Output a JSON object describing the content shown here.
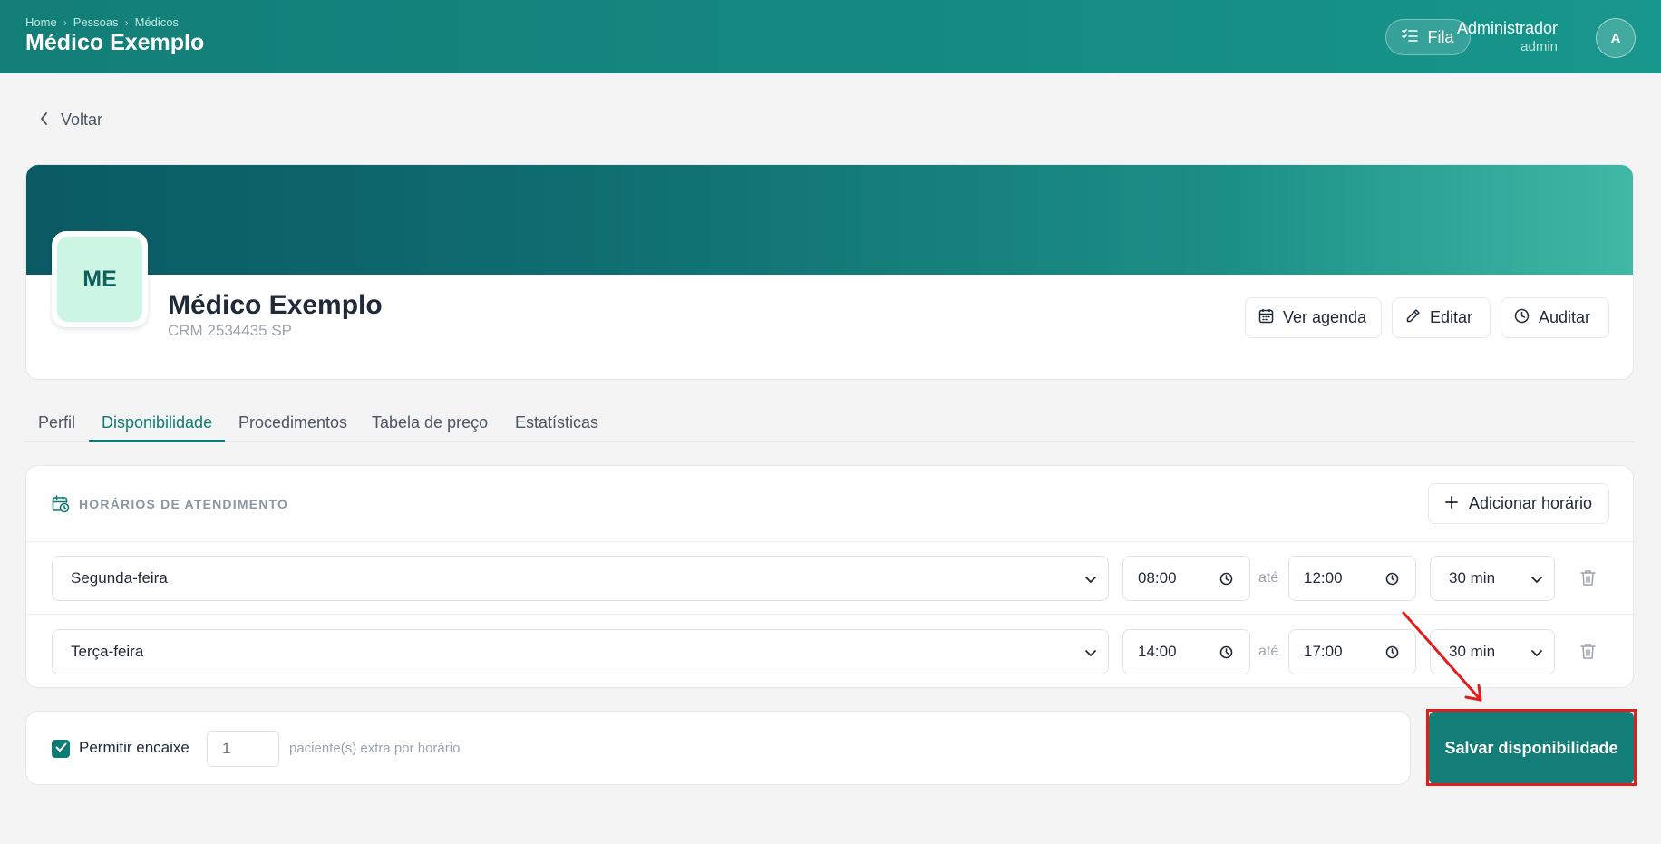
{
  "header": {
    "breadcrumb": [
      "Home",
      "Pessoas",
      "Médicos"
    ],
    "title": "Médico Exemplo",
    "queue_button": "Fila",
    "user_name": "Administrador",
    "user_role": "admin",
    "avatar_initial": "A"
  },
  "back_label": "Voltar",
  "profile": {
    "initials": "ME",
    "name": "Médico Exemplo",
    "crm": "CRM 2534435 SP",
    "actions": {
      "schedule": "Ver agenda",
      "edit": "Editar",
      "audit": "Auditar"
    }
  },
  "tabs": [
    "Perfil",
    "Disponibilidade",
    "Procedimentos",
    "Tabela de preço",
    "Estatísticas"
  ],
  "active_tab": "Disponibilidade",
  "schedule": {
    "title": "HORÁRIOS DE ATENDIMENTO",
    "add_button": "Adicionar horário",
    "separator": "até",
    "rows": [
      {
        "day": "Segunda-feira",
        "start": "08:00",
        "end": "12:00",
        "interval": "30 min"
      },
      {
        "day": "Terça-feira",
        "start": "14:00",
        "end": "17:00",
        "interval": "30 min"
      }
    ]
  },
  "encaixe": {
    "label": "Permitir encaixe",
    "checked": true,
    "value": "1",
    "hint": "paciente(s) extra por horário"
  },
  "save_button": "Salvar disponibilidade",
  "colors": {
    "primary": "#137e78",
    "highlight": "#e11d1d",
    "avatar_bg": "#cdf5e4"
  }
}
